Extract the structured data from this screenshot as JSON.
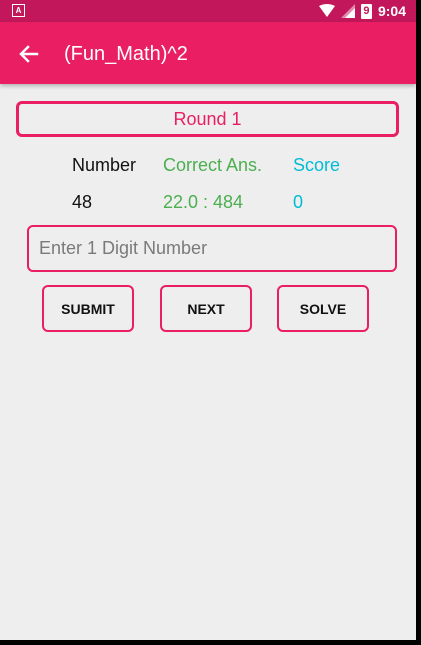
{
  "status_bar": {
    "time": "9:04",
    "notification_icon": "app-notification-icon",
    "battery_level_text": "9"
  },
  "app_bar": {
    "back_icon": "arrow-back-icon",
    "title": "(Fun_Math)^2"
  },
  "round": {
    "label": "Round 1"
  },
  "stats": {
    "headers": {
      "number": "Number",
      "correct": "Correct Ans.",
      "score": "Score"
    },
    "values": {
      "number": "48",
      "correct": "22.0 : 484",
      "score": "0"
    }
  },
  "input": {
    "placeholder": "Enter 1 Digit Number",
    "value": ""
  },
  "buttons": {
    "submit": "SUBMIT",
    "next": "NEXT",
    "solve": "SOLVE"
  },
  "colors": {
    "accent": "#e91e63",
    "status_bar": "#c2185b",
    "correct_green": "#4caf50",
    "score_cyan": "#00bcd4",
    "background": "#eeeeee"
  }
}
